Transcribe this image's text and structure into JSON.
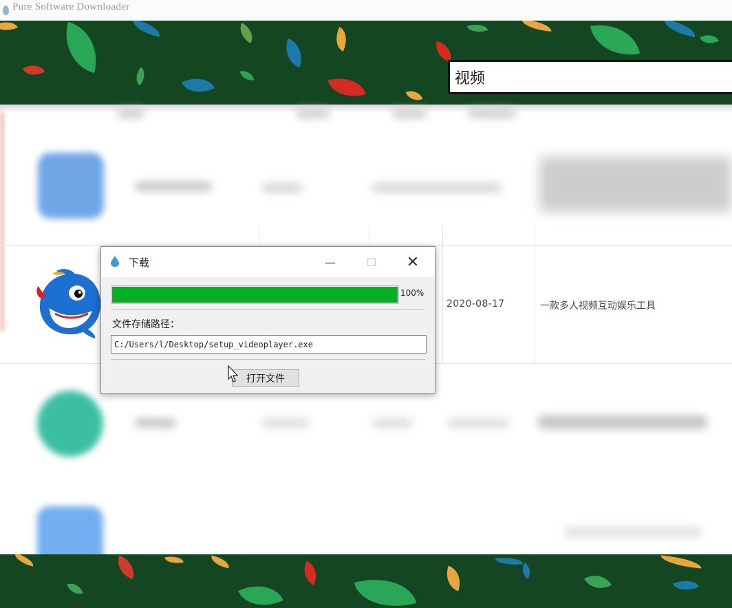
{
  "app": {
    "title": "Pure Software Downloader"
  },
  "search": {
    "value": "视频"
  },
  "list": {
    "featured_row": {
      "date": "2020-08-17",
      "description": "一款多人视频互动娱乐工具"
    }
  },
  "dialog": {
    "title": "下载",
    "progress": {
      "percent_label": "100%",
      "value": 1.0
    },
    "path_label": "文件存储路径：",
    "path_value": "C:/Users/l/Desktop/setup_videoplayer.exe",
    "open_button": "打开文件",
    "controls": {
      "minimize": "—",
      "maximize": "☐",
      "close": "✕"
    }
  },
  "colors": {
    "banner_green": "#144622",
    "progress_green": "#06b025"
  },
  "icons": [
    "app-icon",
    "water-drop-icon",
    "dolphin-logo",
    "minimize-icon",
    "maximize-icon",
    "close-icon",
    "mouse-cursor-icon"
  ]
}
